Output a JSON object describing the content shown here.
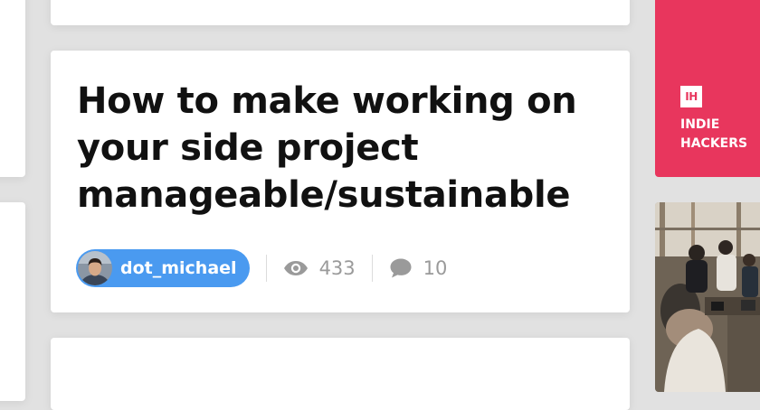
{
  "post": {
    "title": "How to make working on your side project manageable/sustainable",
    "author": "dot_michael",
    "views": "433",
    "comments": "10"
  },
  "icons": {
    "views": "eye-icon",
    "comments": "comment-bubble-icon"
  },
  "sidebar_promo": {
    "logo_text": "IH",
    "name_line1": "INDIE",
    "name_line2": "HACKERS"
  },
  "colors": {
    "background": "#e1e1e1",
    "card": "#ffffff",
    "author_pill": "#4a9af0",
    "brand": "#e8365d",
    "title": "#111111",
    "meta": "#9a9a9a"
  }
}
